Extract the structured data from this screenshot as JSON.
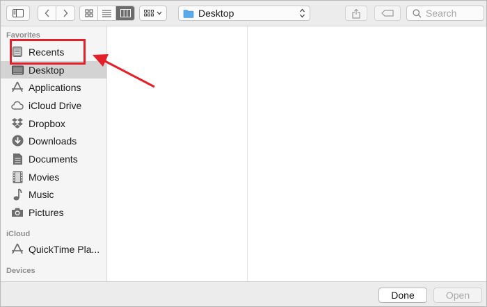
{
  "toolbar": {
    "path_label": "Desktop",
    "search_placeholder": "Search"
  },
  "sidebar": {
    "favorites_header": "Favorites",
    "favorites": [
      {
        "label": "Recents",
        "icon": "recents-icon"
      },
      {
        "label": "Desktop",
        "icon": "desktop-icon",
        "selected": true
      },
      {
        "label": "Applications",
        "icon": "applications-icon"
      },
      {
        "label": "iCloud Drive",
        "icon": "cloud-icon"
      },
      {
        "label": "Dropbox",
        "icon": "dropbox-icon"
      },
      {
        "label": "Downloads",
        "icon": "downloads-icon"
      },
      {
        "label": "Documents",
        "icon": "documents-icon"
      },
      {
        "label": "Movies",
        "icon": "movies-icon"
      },
      {
        "label": "Music",
        "icon": "music-icon"
      },
      {
        "label": "Pictures",
        "icon": "pictures-icon"
      }
    ],
    "icloud_header": "iCloud",
    "icloud": [
      {
        "label": "QuickTime Pla...",
        "icon": "applications-icon"
      }
    ],
    "devices_header": "Devices"
  },
  "footer": {
    "done_label": "Done",
    "open_label": "Open"
  },
  "colors": {
    "annotation": "#e3202a",
    "selection": "#d3d3d3",
    "folder_blue": "#5aa9e8"
  }
}
